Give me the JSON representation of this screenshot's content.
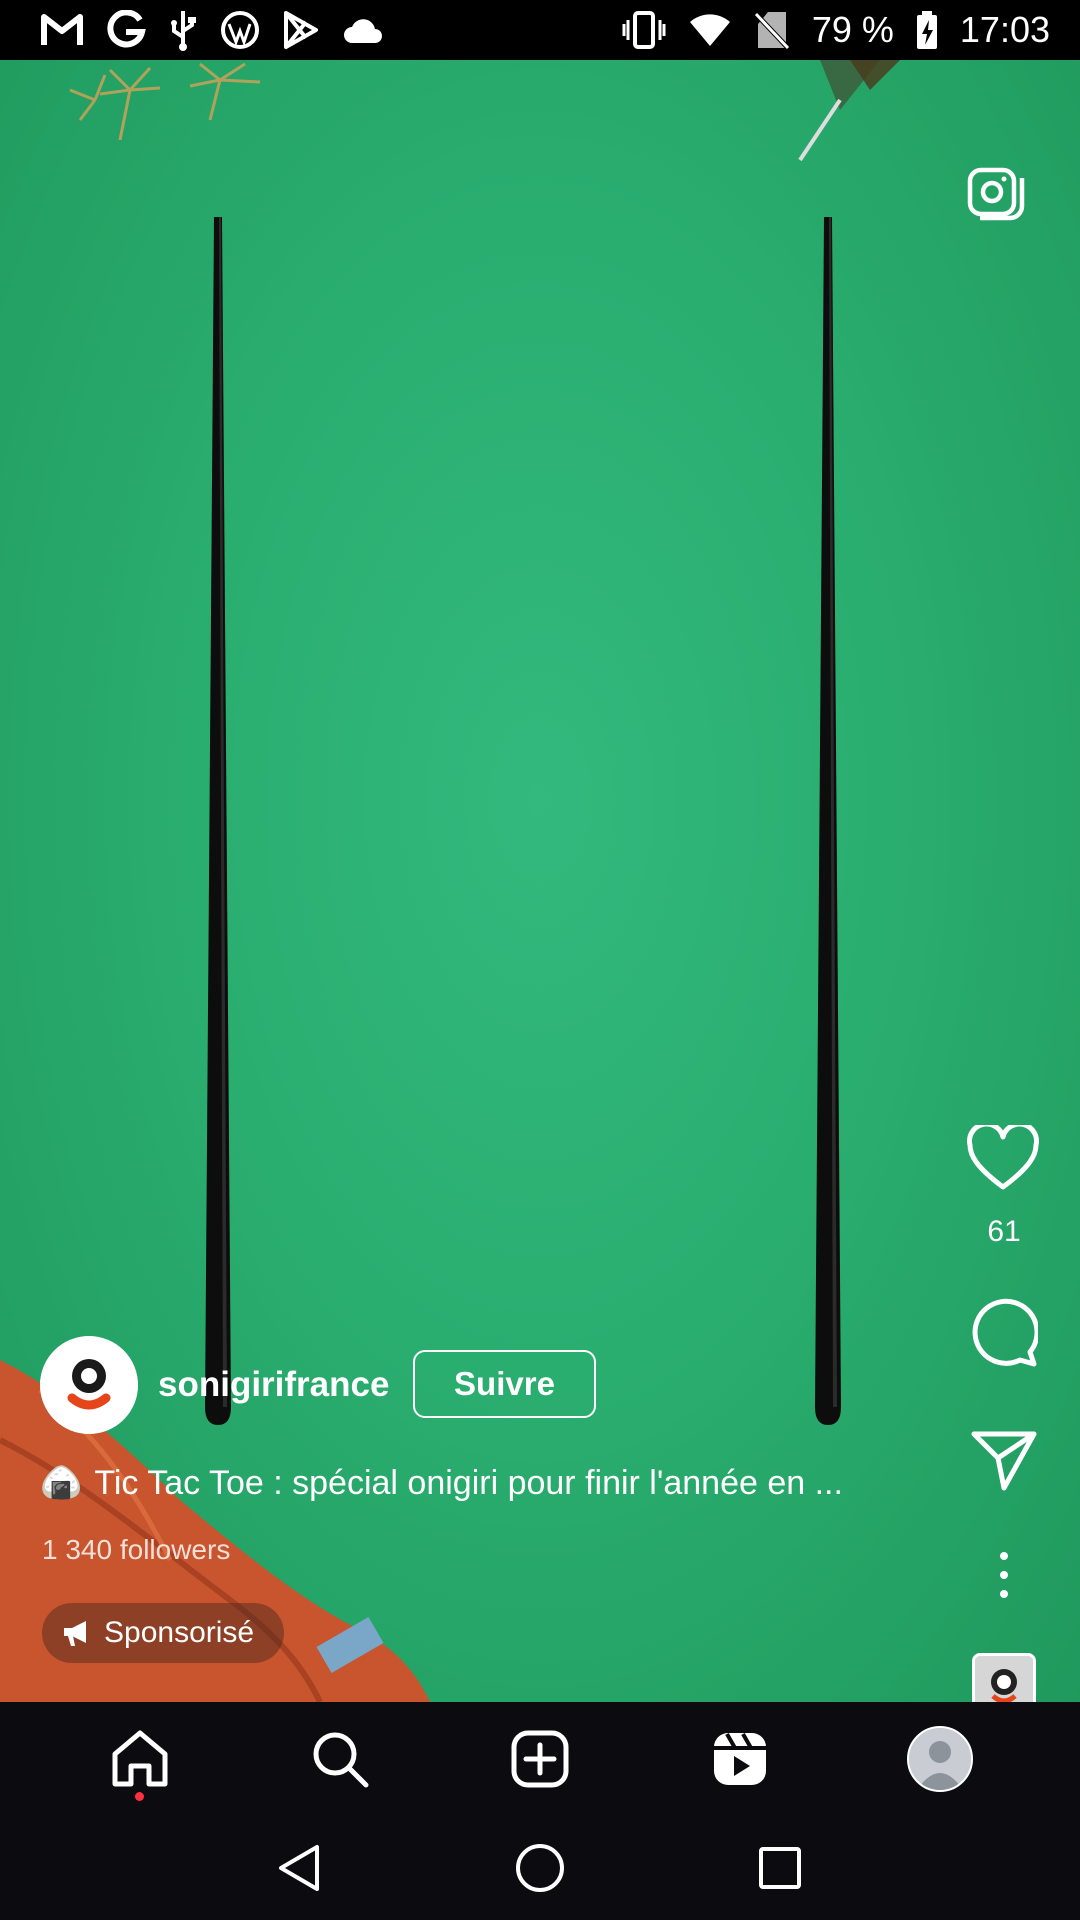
{
  "status_bar": {
    "battery_percent": "79 %",
    "time": "17:03",
    "left_icons": [
      "gmail-icon",
      "google-icon",
      "usb-icon",
      "wordpress-icon",
      "play-store-icon",
      "cloud-icon"
    ],
    "right_icons": [
      "vibrate-icon",
      "wifi-icon",
      "no-sim-icon",
      "battery-charging-icon"
    ]
  },
  "reel": {
    "account": {
      "username": "sonigirifrance",
      "follow_label": "Suivre"
    },
    "caption": {
      "emoji": "🍙",
      "text": "Tic Tac Toe : spécial onigiri pour finir l'année en ..."
    },
    "followers": "1 340 followers",
    "sponsored_label": "Sponsorisé",
    "actions": {
      "like_count": "61"
    }
  },
  "bottom_nav": {
    "items": [
      "home",
      "search",
      "create",
      "reels",
      "profile"
    ],
    "active": "home"
  },
  "colors": {
    "video_green": "#2aae70",
    "notification_dot": "#ff3040",
    "nav_background": "#0b0b10"
  }
}
